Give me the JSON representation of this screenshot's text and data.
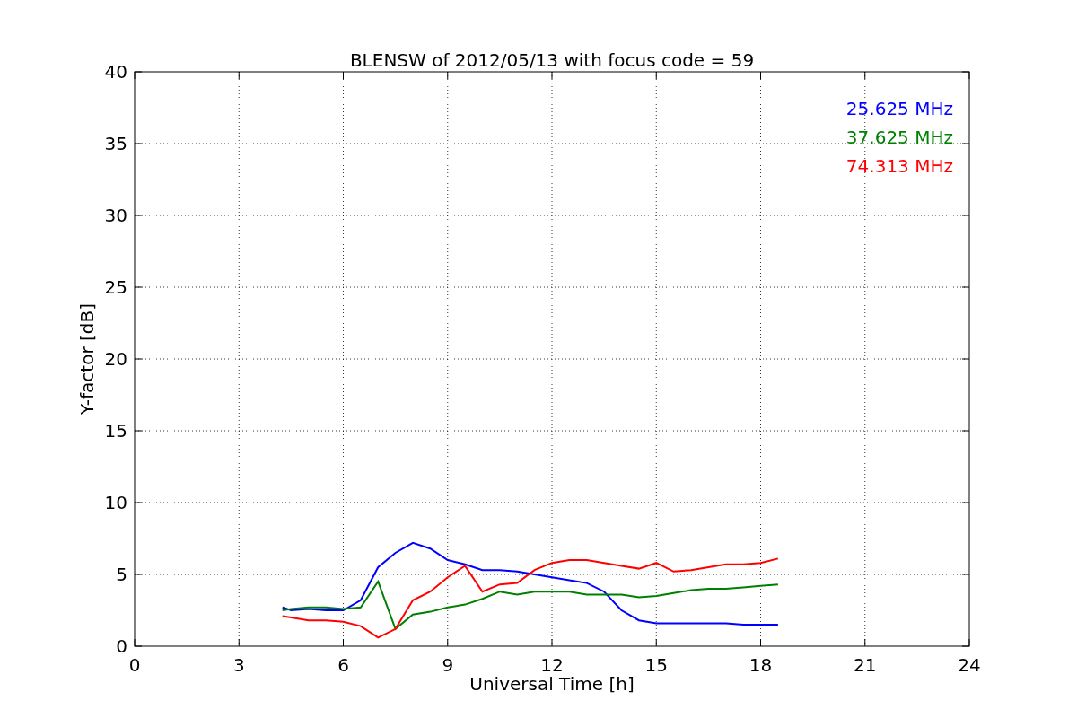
{
  "figure": {
    "chart_data": {
      "type": "line",
      "title": "BLENSW of 2012/05/13 with focus code = 59",
      "xlabel": "Universal Time [h]",
      "ylabel": "Y-factor [dB]",
      "x": [
        4.25,
        4.5,
        5,
        5.5,
        6,
        6.5,
        7,
        7.5,
        8,
        8.5,
        9,
        9.5,
        10,
        10.5,
        11,
        11.5,
        12,
        12.5,
        13,
        13.5,
        14,
        14.5,
        15,
        15.5,
        16,
        16.5,
        17,
        17.5,
        18,
        18.5
      ],
      "series": [
        {
          "name": "25.625 MHz",
          "color": "#0000ff",
          "values": [
            2.7,
            2.5,
            2.6,
            2.5,
            2.5,
            3.2,
            5.5,
            6.5,
            7.2,
            6.8,
            6.0,
            5.7,
            5.3,
            5.3,
            5.2,
            5.0,
            4.8,
            4.6,
            4.4,
            3.8,
            2.5,
            1.8,
            1.6,
            1.6,
            1.6,
            1.6,
            1.6,
            1.5,
            1.5,
            1.5
          ]
        },
        {
          "name": "37.625 MHz",
          "color": "#008000",
          "values": [
            2.5,
            2.6,
            2.7,
            2.7,
            2.6,
            2.7,
            4.5,
            1.2,
            2.2,
            2.4,
            2.7,
            2.9,
            3.3,
            3.8,
            3.6,
            3.8,
            3.8,
            3.8,
            3.6,
            3.6,
            3.6,
            3.4,
            3.5,
            3.7,
            3.9,
            4.0,
            4.0,
            4.1,
            4.2,
            4.3
          ]
        },
        {
          "name": "74.313 MHz",
          "color": "#ff0000",
          "values": [
            2.1,
            2.0,
            1.8,
            1.8,
            1.7,
            1.4,
            0.6,
            1.2,
            3.2,
            3.8,
            4.8,
            5.6,
            3.8,
            4.3,
            4.4,
            5.3,
            5.8,
            6.0,
            6.0,
            5.8,
            5.6,
            5.4,
            5.8,
            5.2,
            5.3,
            5.5,
            5.7,
            5.7,
            5.8,
            6.1
          ]
        }
      ],
      "xlim": [
        0,
        24
      ],
      "ylim": [
        0,
        40
      ],
      "xticks": [
        0,
        3,
        6,
        9,
        12,
        15,
        18,
        21,
        24
      ],
      "yticks": [
        0,
        5,
        10,
        15,
        20,
        25,
        30,
        35,
        40
      ],
      "grid": true
    }
  }
}
